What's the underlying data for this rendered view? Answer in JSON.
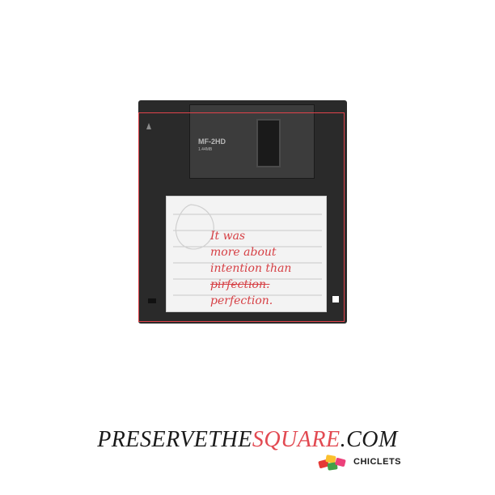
{
  "disk": {
    "format_label": "MF-2HD",
    "capacity_label": "1.44MB"
  },
  "note": {
    "lines": [
      "It was",
      "more about",
      "intention than"
    ],
    "struck_word": "pirfection.",
    "corrected_word": "perfection."
  },
  "brand": {
    "prefix": "PRESERVETHE",
    "accent": "SQUARE",
    "suffix": ".COM",
    "accent_color": "#e24a52"
  },
  "logo": {
    "name": "CHICLETS",
    "icon": "chiclets-candy-icon"
  },
  "colors": {
    "ink": "#d64045",
    "frame": "#e0434b",
    "disk": "#2a2a2a"
  }
}
